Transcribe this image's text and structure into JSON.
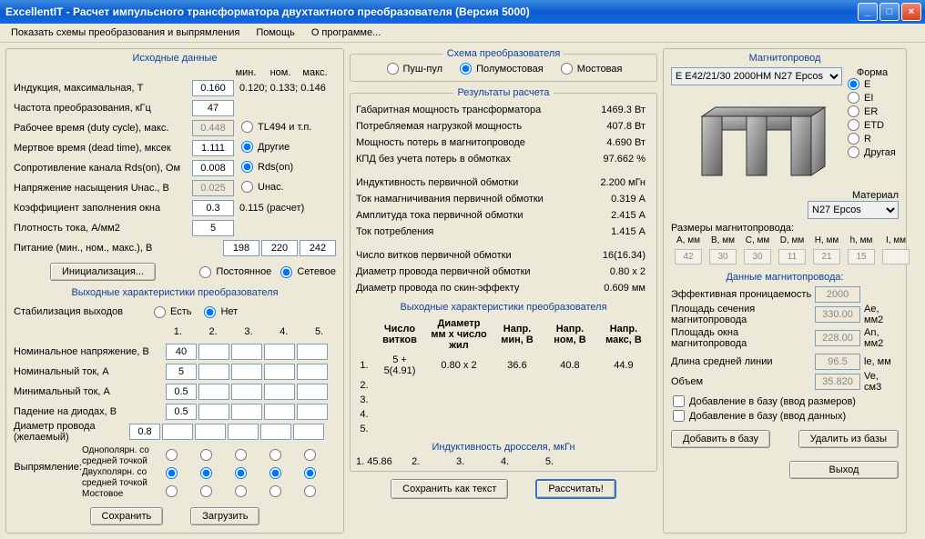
{
  "window": {
    "title": "ExcellentIT - Расчет импульсного трансформатора двухтактного преобразователя (Версия 5000)"
  },
  "menu": {
    "item1": "Показать схемы преобразования и выпрямления",
    "item2": "Помощь",
    "item3": "О программе..."
  },
  "left": {
    "title": "Исходные данные",
    "hdr_min": "мин.",
    "hdr_nom": "ном.",
    "hdr_max": "макс.",
    "induction": {
      "label": "Индукция, максимальная, Т",
      "value": "0.160",
      "hint": "0.120; 0.133; 0.146"
    },
    "freq": {
      "label": "Частота преобразования, кГц",
      "value": "47"
    },
    "duty": {
      "label": "Рабочее время (duty cycle), макс.",
      "value": "0.448",
      "opt1": "TL494 и т.п.",
      "opt2": "Другие"
    },
    "dead": {
      "label": "Мертвое время (dead time), мксек",
      "value": "1.111"
    },
    "rds": {
      "label": "Сопротивление канала Rds(on), Ом",
      "value": "0.008",
      "opt": "Rds(on)"
    },
    "usat": {
      "label": "Напряжение насыщения Uнас., В",
      "value": "0.025",
      "opt": "Uнас."
    },
    "fill": {
      "label": "Коэффициент заполнения окна",
      "value": "0.3",
      "hint": "0.115 (расчет)"
    },
    "density": {
      "label": "Плотность тока, А/мм2",
      "value": "5"
    },
    "power": {
      "label": "Питание (мин., ном., макс.), В",
      "v1": "198",
      "v2": "220",
      "v3": "242"
    },
    "init_btn": "Инициализация...",
    "power_type": {
      "opt1": "Постоянное",
      "opt2": "Сетевое"
    },
    "out_title": "Выходные характеристики преобразователя",
    "stab": {
      "label": "Стабилизация выходов",
      "yes": "Есть",
      "no": "Нет"
    },
    "cols": {
      "c1": "1.",
      "c2": "2.",
      "c3": "3.",
      "c4": "4.",
      "c5": "5."
    },
    "nomV": {
      "label": "Номинальное напряжение, В",
      "v": "40"
    },
    "nomI": {
      "label": "Номинальный ток, А",
      "v": "5"
    },
    "minI": {
      "label": "Минимальный ток, А",
      "v": "0.5"
    },
    "diode": {
      "label": "Падение на диодах, В",
      "v": "0.5"
    },
    "wire": {
      "label": "Диаметр провода (желаемый)",
      "v": "0.8"
    },
    "rect_label": "Выпрямление:",
    "rect1": "Однополярн. со средней точкой",
    "rect2": "Двухполярн. со средней точкой",
    "rect3": "Мостовое",
    "save_btn": "Сохранить",
    "load_btn": "Загрузить"
  },
  "center": {
    "schema_title": "Схема преобразователя",
    "schema": {
      "opt1": "Пуш-пул",
      "opt2": "Полумостовая",
      "opt3": "Мостовая"
    },
    "results_title": "Результаты расчета",
    "r": [
      [
        "Габаритная мощность трансформатора",
        "1469.3 Вт"
      ],
      [
        "Потребляемая нагрузкой мощность",
        "407.8 Вт"
      ],
      [
        "Мощность потерь в магнитопроводе",
        "4.690 Вт"
      ],
      [
        "КПД без учета потерь в обмотках",
        "97.662 %"
      ]
    ],
    "r2": [
      [
        "Индуктивность первичной обмотки",
        "2.200 мГн"
      ],
      [
        "Ток намагничивания первичной обмотки",
        "0.319 А"
      ],
      [
        "Амплитуда тока первичной обмотки",
        "2.415 А"
      ],
      [
        "Ток потребления",
        "1.415 А"
      ]
    ],
    "r3": [
      [
        "Число витков первичной обмотки",
        "16(16.34)"
      ],
      [
        "Диаметр провода первичной обмотки",
        "0.80 x 2"
      ],
      [
        "Диаметр провода по скин-эффекту",
        "0.609 мм"
      ]
    ],
    "out_title": "Выходные характеристики преобразователя",
    "out_hdr": {
      "c1": "Число витков",
      "c2": "Диаметр мм x число жил",
      "c3": "Напр. мин, В",
      "c4": "Напр. ном, В",
      "c5": "Напр. макс, В"
    },
    "out_rows": {
      "r1": {
        "n": "1.",
        "turns": "5 + 5(4.91)",
        "dia": "0.80 x 2",
        "vmin": "36.6",
        "vnom": "40.8",
        "vmax": "44.9"
      },
      "r2": {
        "n": "2."
      },
      "r3": {
        "n": "3."
      },
      "r4": {
        "n": "4."
      },
      "r5": {
        "n": "5."
      }
    },
    "choke_title": "Индуктивность дросселя, мкГн",
    "choke": "1. 45.86       2.             3.             4.             5.",
    "save_txt_btn": "Сохранить как текст",
    "calc_btn": "Рассчитать!"
  },
  "right": {
    "title": "Магнитопровод",
    "core_select": "E E42/21/30 2000HM N27 Epcos",
    "shape_label": "Форма",
    "shapes": {
      "e": "E",
      "ei": "EI",
      "er": "ER",
      "etd": "ETD",
      "r": "R",
      "other": "Другая"
    },
    "material_label": "Материал",
    "material": "N27 Epcos",
    "dims_label": "Размеры магнитопровода:",
    "dims_hdr": {
      "a": "A, мм",
      "b": "B, мм",
      "c": "C, мм",
      "d": "D, мм",
      "h": "H, мм",
      "hh": "h, мм",
      "i": "I, мм"
    },
    "dims": {
      "a": "42",
      "b": "30",
      "c": "30",
      "d": "11",
      "h": "21",
      "hh": "15",
      "i": ""
    },
    "core_data_title": "Данные магнитопровода:",
    "cd": {
      "perm": {
        "label": "Эффективная проницаемость",
        "v": "2000",
        "u": ""
      },
      "area": {
        "label": "Площадь сечения магнитопровода",
        "v": "330.00",
        "u": "Ae, мм2"
      },
      "window": {
        "label": "Площадь окна магнитопровода",
        "v": "228.00",
        "u": "An, мм2"
      },
      "len": {
        "label": "Длина средней линии",
        "v": "96.5",
        "u": "le, мм"
      },
      "vol": {
        "label": "Объем",
        "v": "35.820",
        "u": "Ve, см3"
      }
    },
    "addbase1": "Добавление в базу (ввод размеров)",
    "addbase2": "Добавление в базу (ввод данных)",
    "add_btn": "Добавить в базу",
    "del_btn": "Удалить из базы",
    "exit_btn": "Выход"
  }
}
